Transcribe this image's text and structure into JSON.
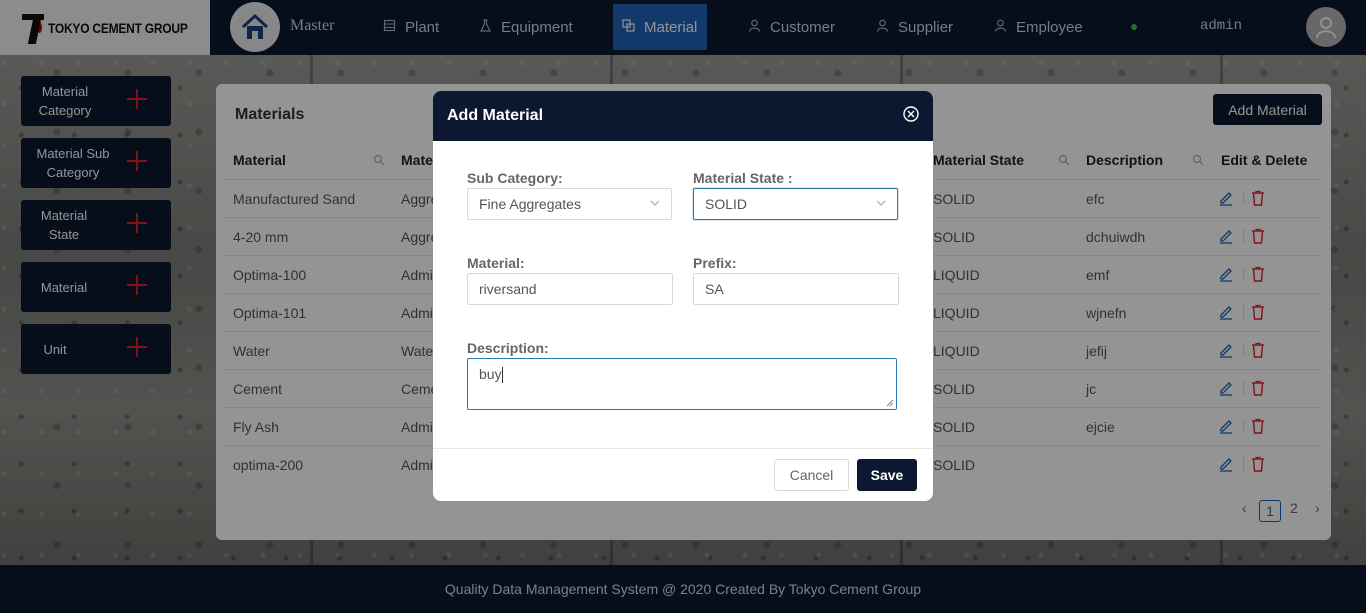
{
  "brand": {
    "logo_text": "TOKYO CEMENT GROUP"
  },
  "nav": {
    "master": "Master",
    "items": [
      {
        "label": "Plant",
        "icon": "building-icon"
      },
      {
        "label": "Equipment",
        "icon": "flask-icon"
      },
      {
        "label": "Material",
        "icon": "layers-icon",
        "active": true
      },
      {
        "label": "Customer",
        "icon": "user-icon"
      },
      {
        "label": "Supplier",
        "icon": "user-icon"
      },
      {
        "label": "Employee",
        "icon": "user-icon"
      }
    ],
    "user": "admin"
  },
  "sidebar": {
    "items": [
      {
        "label": "Material Category"
      },
      {
        "label": "Material Sub Category"
      },
      {
        "label": "Material State"
      },
      {
        "label": "Material"
      },
      {
        "label": "Unit"
      }
    ]
  },
  "materials": {
    "title": "Materials",
    "add_button": "Add Material",
    "columns": [
      "Material",
      "Material Category",
      "Material State",
      "Description",
      "Edit & Delete"
    ],
    "col_category_visible": "Mate",
    "rows": [
      {
        "material": "Manufactured Sand",
        "category": "Aggre",
        "state": "SOLID",
        "description": "efc"
      },
      {
        "material": "4-20 mm",
        "category": "Aggre",
        "state": "SOLID",
        "description": "dchuiwdh"
      },
      {
        "material": "Optima-100",
        "category": "Admi",
        "state": "LIQUID",
        "description": "emf"
      },
      {
        "material": "Optima-101",
        "category": "Admi",
        "state": "LIQUID",
        "description": "wjnefn"
      },
      {
        "material": "Water",
        "category": "Wate",
        "state": "LIQUID",
        "description": "jefij"
      },
      {
        "material": "Cement",
        "category": "Ceme",
        "state": "SOLID",
        "description": "jc"
      },
      {
        "material": "Fly Ash",
        "category": "Admi",
        "state": "SOLID",
        "description": "ejcie"
      },
      {
        "material": "optima-200",
        "category": "Admi",
        "state": "SOLID",
        "description": ""
      }
    ],
    "pagination": {
      "current": "1",
      "next_page": "2"
    }
  },
  "modal": {
    "title": "Add Material",
    "sub_category_label": "Sub Category:",
    "sub_category_value": "Fine Aggregates",
    "state_label": "Material State :",
    "state_value": "SOLID",
    "material_label": "Material:",
    "material_value": "riversand",
    "prefix_label": "Prefix:",
    "prefix_value": "SA",
    "description_label": "Description:",
    "description_value": "buy",
    "cancel": "Cancel",
    "save": "Save"
  },
  "footer": {
    "text": "Quality Data Management System @ 2020 Created By Tokyo Cement Group"
  },
  "colors": {
    "navy": "#0c1830",
    "accent": "#1e63b5",
    "danger": "#e0202a"
  }
}
